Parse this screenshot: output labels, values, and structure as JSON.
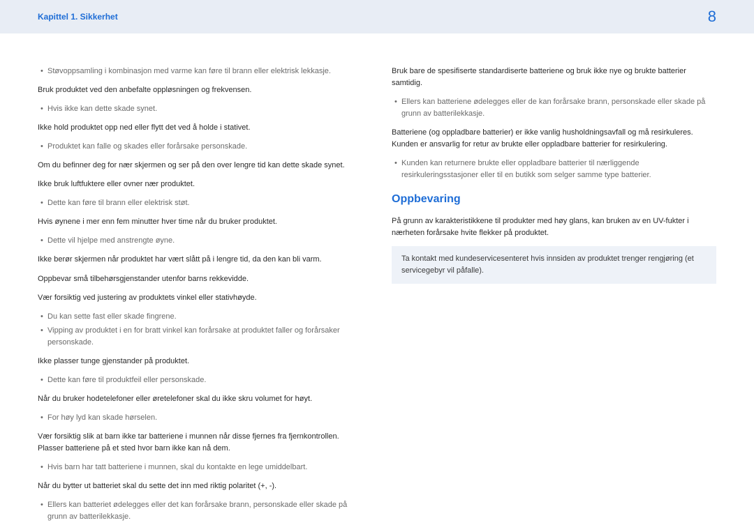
{
  "header": {
    "chapter": "Kapittel 1. Sikkerhet",
    "page_number": "8"
  },
  "left_column": [
    {
      "type": "ul",
      "items": [
        "Støvoppsamling i kombinasjon med varme kan føre til brann eller elektrisk lekkasje."
      ]
    },
    {
      "type": "p",
      "text": "Bruk produktet ved den anbefalte oppløsningen og frekvensen."
    },
    {
      "type": "ul",
      "items": [
        "Hvis ikke kan dette skade synet."
      ]
    },
    {
      "type": "p",
      "text": "Ikke hold produktet opp ned eller flytt det ved å holde i stativet."
    },
    {
      "type": "ul",
      "items": [
        "Produktet kan falle og skades eller forårsake personskade."
      ]
    },
    {
      "type": "p",
      "text": "Om du befinner deg for nær skjermen og ser på den over lengre tid kan dette skade synet."
    },
    {
      "type": "p",
      "text": "Ikke bruk luftfuktere eller ovner nær produktet."
    },
    {
      "type": "ul",
      "items": [
        "Dette kan føre til brann eller elektrisk støt."
      ]
    },
    {
      "type": "p",
      "text": "Hvis øynene i mer enn fem minutter hver time når du bruker produktet."
    },
    {
      "type": "ul",
      "items": [
        "Dette vil hjelpe med anstrengte øyne."
      ]
    },
    {
      "type": "p",
      "text": "Ikke berør skjermen når produktet har vært slått på i lengre tid, da den kan bli varm."
    },
    {
      "type": "p",
      "text": "Oppbevar små tilbehørsgjenstander utenfor barns rekkevidde."
    },
    {
      "type": "p",
      "text": "Vær forsiktig ved justering av produktets vinkel eller stativhøyde."
    },
    {
      "type": "ul",
      "items": [
        "Du kan sette fast eller skade fingrene.",
        "Vipping av produktet i en for bratt vinkel kan forårsake at produktet faller og forårsaker personskade."
      ]
    },
    {
      "type": "p",
      "text": "Ikke plasser tunge gjenstander på produktet."
    },
    {
      "type": "ul",
      "items": [
        "Dette kan føre til produktfeil eller personskade."
      ]
    },
    {
      "type": "p",
      "text": "Når du bruker hodetelefoner eller øretelefoner skal du ikke skru volumet for høyt."
    },
    {
      "type": "ul",
      "items": [
        "For høy lyd kan skade hørselen."
      ]
    },
    {
      "type": "p",
      "text": "Vær forsiktig slik at barn ikke tar batteriene i munnen når disse fjernes fra fjernkontrollen. Plasser batteriene på et sted hvor barn ikke kan nå dem."
    },
    {
      "type": "ul",
      "items": [
        "Hvis barn har tatt batteriene i munnen, skal du kontakte en lege umiddelbart."
      ]
    },
    {
      "type": "p",
      "text": "Når du bytter ut batteriet skal du sette det inn med riktig polaritet (+, -)."
    },
    {
      "type": "ul",
      "items": [
        "Ellers kan batteriet ødelegges eller det kan forårsake brann, personskade eller skade på grunn av batterilekkasje."
      ]
    }
  ],
  "right_column": [
    {
      "type": "p",
      "text": "Bruk bare de spesifiserte standardiserte batteriene og bruk ikke nye og brukte batterier samtidig."
    },
    {
      "type": "ul",
      "items": [
        "Ellers kan batteriene ødelegges eller de kan forårsake brann, personskade eller skade på grunn av batterilekkasje."
      ]
    },
    {
      "type": "p",
      "text": "Batteriene (og oppladbare batterier) er ikke vanlig husholdningsavfall og må resirkuleres. Kunden er ansvarlig for retur av brukte eller oppladbare batterier for resirkulering."
    },
    {
      "type": "ul",
      "items": [
        "Kunden kan returnere brukte eller oppladbare batterier til nærliggende resirkuleringsstasjoner eller til en butikk som selger samme type batterier."
      ]
    },
    {
      "type": "stitle",
      "text": "Oppbevaring"
    },
    {
      "type": "p",
      "text": "På grunn av karakteristikkene til produkter med høy glans, kan bruken av en UV-fukter i nærheten forårsake hvite flekker på produktet."
    },
    {
      "type": "note",
      "text": "Ta kontakt med kundeservicesenteret hvis innsiden av produktet trenger rengjøring (et servicegebyr vil påfalle)."
    }
  ]
}
